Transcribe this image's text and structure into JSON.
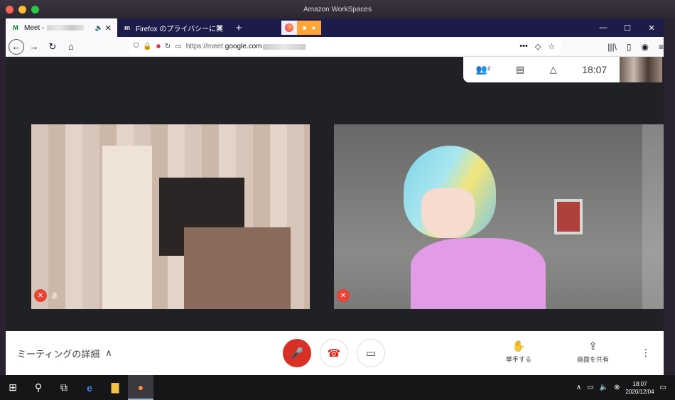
{
  "mac": {
    "title": "Amazon WorkSpaces"
  },
  "tabs": [
    {
      "label": "Meet -",
      "favicon": "M"
    },
    {
      "label": "Firefox のプライバシーに関する通知",
      "favicon": "m"
    }
  ],
  "tab_close": "✕",
  "newtab": "+",
  "window_controls": {
    "minimize": "—",
    "maximize": "☐",
    "close": "✕"
  },
  "nav": {
    "back": "←",
    "forward": "→",
    "reload": "↻",
    "home": "⌂"
  },
  "url": {
    "prefix": "https://meet.",
    "domain": "google.com"
  },
  "nav_right": {
    "library": "|||\\",
    "sidebar": "▯",
    "account": "◉",
    "menu": "≡"
  },
  "url_right": {
    "more": "•••",
    "pocket": "◇",
    "star": "☆"
  },
  "meet": {
    "people_icon": "👥²",
    "chat_icon": "▤",
    "activities_icon": "△",
    "time": "18:07",
    "tile1_name": "あ",
    "tile2_name": ""
  },
  "bottom": {
    "details_label": "ミーティングの詳細",
    "details_chevron": "∧",
    "raise_hand": "挙手する",
    "share_screen": "画面を共有",
    "more": "⋮"
  },
  "taskbar": {
    "time": "18:07",
    "date": "2020/12/04"
  },
  "colors": {
    "tabstrip": "#1d1b4a",
    "hangup": "#d93025",
    "mic_off": "#ea4335"
  }
}
